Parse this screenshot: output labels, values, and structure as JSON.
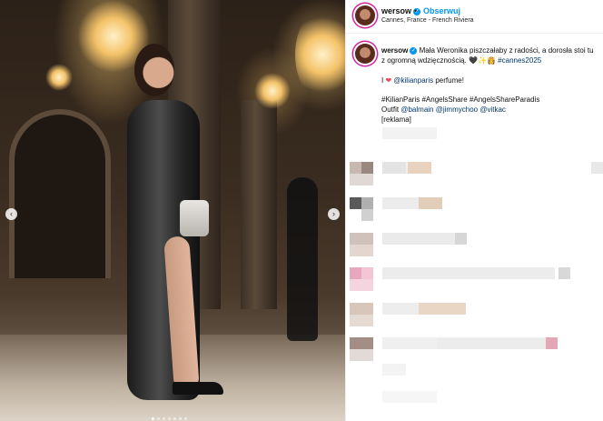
{
  "post": {
    "username": "wersow",
    "follow_label": "Obserwuj",
    "separator": "•",
    "location": "Cannes, France - French Riviera"
  },
  "caption": {
    "text": "Mała Weronika piszczałaby z radości, a dorosła stoi tu z ogromną wdzięcznością. 🖤✨👸",
    "hashtag": "#cannes2025",
    "love_prefix": "I",
    "heart": "❤",
    "mention_kilian": "@kilianparis",
    "perfume_suffix": "perfume!",
    "hashtags_line": "#KilianParis #AngelsShare #AngelsShareParadis",
    "outfit_label": "Outfit",
    "mention_balmain": "@balmain",
    "mention_jimmychoo": "@jimmychoo",
    "mention_vitkac": "@vitkac",
    "reklama": "[reklama]"
  },
  "carousel": {
    "prev_icon": "‹",
    "next_icon": "›",
    "slides_count": 7,
    "active_slide": 1
  },
  "colors": {
    "link": "#00376b",
    "accent": "#0095f6",
    "heart": "#ed4956"
  }
}
